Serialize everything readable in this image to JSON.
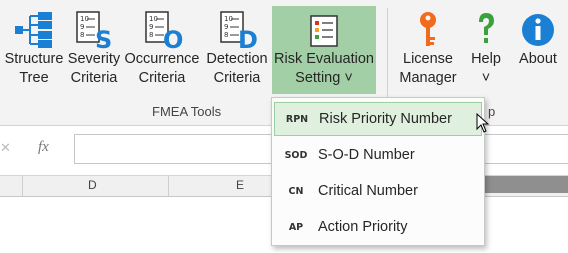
{
  "ribbon": {
    "buttons": [
      {
        "label_line1": "Structure",
        "label_line2": "Tree",
        "icon": "structure-tree-icon"
      },
      {
        "label_line1": "Severity",
        "label_line2": "Criteria",
        "icon": "severity-criteria-icon",
        "letter": "S"
      },
      {
        "label_line1": "Occurrence",
        "label_line2": "Criteria",
        "icon": "occurrence-criteria-icon",
        "letter": "O"
      },
      {
        "label_line1": "Detection",
        "label_line2": "Criteria",
        "icon": "detection-criteria-icon",
        "letter": "D"
      },
      {
        "label_line1": "Risk Evaluation",
        "label_line2": "Setting ˅",
        "icon": "risk-evaluation-icon"
      },
      {
        "label_line1": "License",
        "label_line2": "Manager",
        "icon": "key-icon"
      },
      {
        "label_line1": "Help",
        "label_line2": "˅",
        "icon": "help-icon"
      },
      {
        "label_line1": "About",
        "label_line2": "",
        "icon": "info-icon"
      }
    ],
    "group_label": "FMEA Tools",
    "group_label_2": "p"
  },
  "formula_bar": {
    "fx": "fx",
    "cancel": "✕"
  },
  "columns": [
    "D",
    "E"
  ],
  "menu": {
    "items": [
      {
        "abbr": "RPN",
        "label": "Risk Priority Number"
      },
      {
        "abbr": "SOD",
        "label": "S-O-D Number"
      },
      {
        "abbr": "CN",
        "label": "Critical Number"
      },
      {
        "abbr": "AP",
        "label": "Action Priority"
      }
    ]
  },
  "colors": {
    "accent_blue": "#1b7fd4",
    "active_green": "#a3cfa6",
    "key_orange": "#f26b1d",
    "help_green": "#3ca13c"
  }
}
